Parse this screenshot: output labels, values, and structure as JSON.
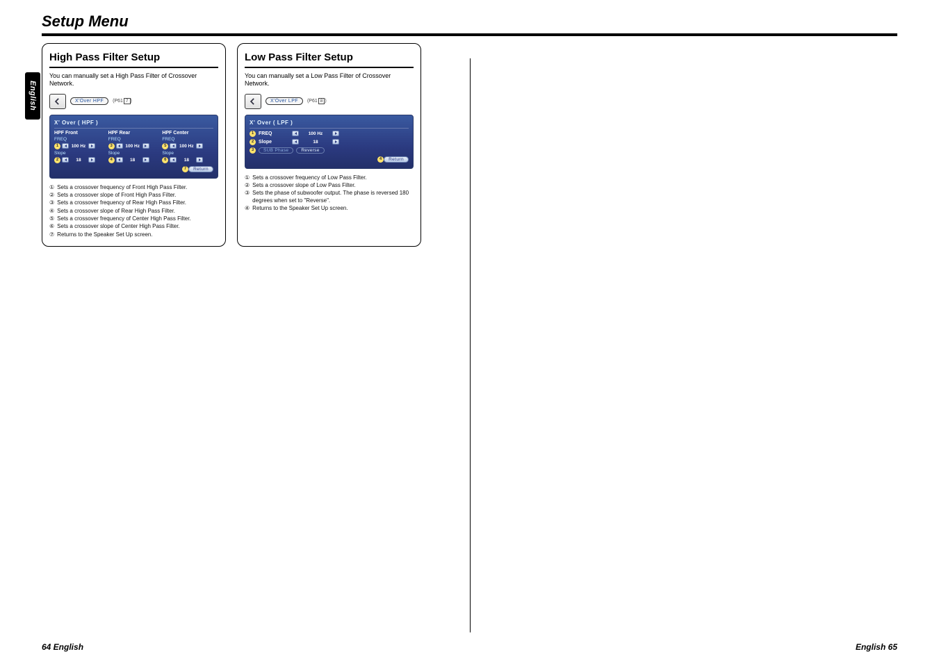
{
  "page": {
    "section_title": "Setup Menu",
    "lang_tab": "English",
    "footer_left": "64 English",
    "footer_right": "English 65"
  },
  "hpf": {
    "heading": "High Pass Filter Setup",
    "intro": "You can manually set a High Pass Filter of Crossover Network.",
    "path_label": "X'Over HPF",
    "path_ref_prefix": "(P61",
    "path_ref_num": "7",
    "path_ref_suffix": ")",
    "screen_title": "X' Over ( HPF )",
    "col1_hdr": "HPF Front",
    "col2_hdr": "HPF Rear",
    "col3_hdr": "HPF Center",
    "freq_label": "FREQ",
    "slope_label": "Slope",
    "freq_val": "100 Hz",
    "slope_val": "18",
    "return_label": "Return",
    "notes": [
      "Sets a crossover frequency of Front High Pass Filter.",
      "Sets a crossover slope of Front High Pass Filter.",
      "Sets a crossover frequency of Rear High Pass Filter.",
      "Sets a crossover slope of Rear High Pass Filter.",
      "Sets a crossover frequency of Center High Pass Filter.",
      "Sets a crossover slope of Center High Pass Filter.",
      "Returns to the Speaker Set Up screen."
    ]
  },
  "lpf": {
    "heading": "Low Pass Filter Setup",
    "intro": "You can manually set a Low Pass Filter of Crossover Network.",
    "path_label": "X'Over LPF",
    "path_ref_prefix": "(P61",
    "path_ref_num": "8",
    "path_ref_suffix": ")",
    "screen_title": "X' Over ( LPF )",
    "freq_label": "FREQ",
    "slope_label": "Slope",
    "freq_val": "100 Hz",
    "slope_val": "18",
    "phase_label": "SUB Phase",
    "phase_val": "Reverse",
    "return_label": "Return",
    "notes": [
      "Sets a crossover frequency of Low Pass Filter.",
      "Sets a crossover slope of Low Pass Filter.",
      "Sets the phase of subwoofer output. The phase is reversed 180 degrees when set to \"Reverse\".",
      "Returns to the Speaker Set Up screen."
    ]
  },
  "nums": {
    "c1": "1",
    "c2": "2",
    "c3": "3",
    "c4": "4",
    "c5": "5",
    "c6": "6",
    "c7": "7"
  }
}
